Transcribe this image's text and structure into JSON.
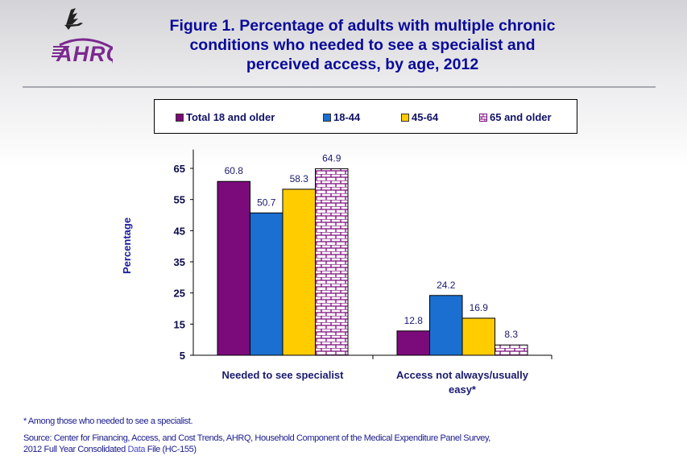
{
  "header": {
    "logo_text": "AHRQ",
    "logo_icon": "hhs-eagle-icon",
    "title_lines": [
      "Figure 1. Percentage of adults with multiple chronic",
      "conditions who needed to see a specialist and",
      "perceived access, by age, 2012"
    ]
  },
  "colors": {
    "total": "#7b0a7b",
    "age_18_44": "#1a6fd1",
    "age_45_64": "#ffcc00",
    "age_65_plus_stroke": "#7b0a7b",
    "age_65_plus_fill": "#ffffff",
    "text_primary": "#0a0a9a"
  },
  "chart_data": {
    "type": "bar",
    "title": "Figure 1. Percentage of adults with multiple chronic conditions who needed to see a specialist and perceived access, by age, 2012",
    "xlabel": "",
    "ylabel": "Percentage",
    "ylim": [
      5,
      70
    ],
    "yticks": [
      5,
      15,
      25,
      35,
      45,
      55,
      65
    ],
    "grid": false,
    "legend_position": "top",
    "categories": [
      "Needed to see specialist",
      "Access not always/usually easy*"
    ],
    "category_label_lines": [
      [
        "Needed to see specialist"
      ],
      [
        "Access not always/usually",
        "easy*"
      ]
    ],
    "series": [
      {
        "name": "Total 18 and older",
        "values": [
          60.8,
          12.8
        ],
        "labels": [
          "60.8",
          "12.8"
        ],
        "pattern": "solid"
      },
      {
        "name": "18-44",
        "values": [
          50.7,
          24.2
        ],
        "labels": [
          "50.7",
          "24.2"
        ],
        "pattern": "solid"
      },
      {
        "name": "45-64",
        "values": [
          58.3,
          16.9
        ],
        "labels": [
          "58.3",
          "16.9"
        ],
        "pattern": "solid"
      },
      {
        "name": "65 and older",
        "values": [
          64.9,
          8.3
        ],
        "labels": [
          "64.9",
          "8.3"
        ],
        "pattern": "brick"
      }
    ]
  },
  "footnotes": {
    "note": "* Among those who needed to see a specialist.",
    "source_line1": "Source: Center for Financing, Access, and Cost Trends, AHRQ, Household Component of the Medical Expenditure Panel Survey,",
    "source_line2_pre": "2012 Full Year Consolidated ",
    "source_link": "Data",
    "source_line2_post": " File (HC-155)"
  }
}
